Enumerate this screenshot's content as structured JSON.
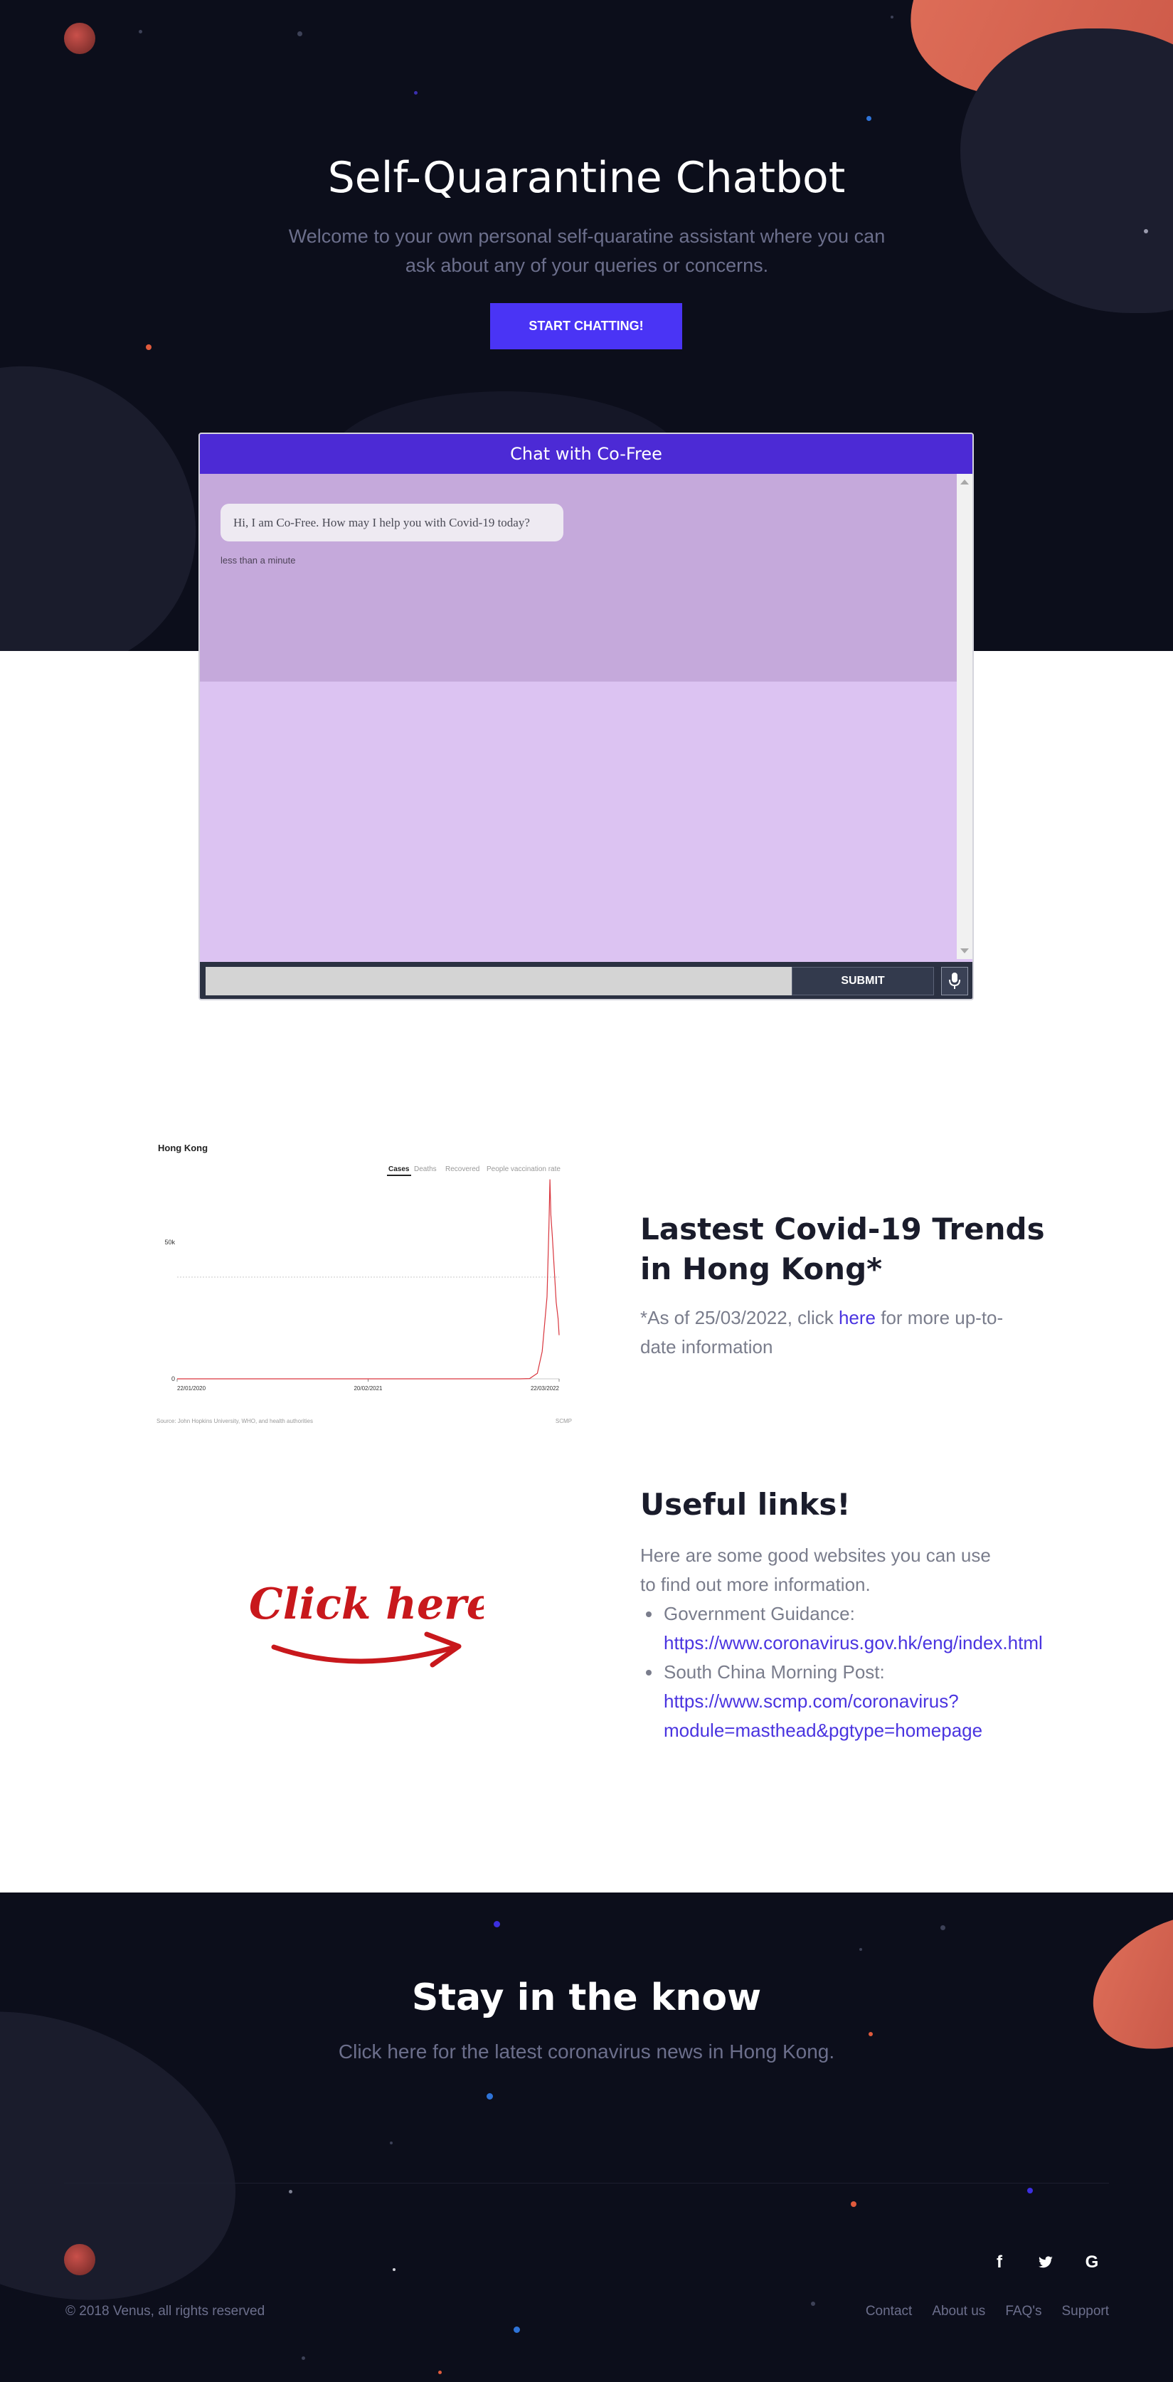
{
  "hero": {
    "title": "Self-Quarantine Chatbot",
    "subtitle": "Welcome to your own personal self-quaratine assistant where you can ask about any of your queries or concerns.",
    "cta_label": "START CHATTING!"
  },
  "chat": {
    "header": "Chat with Co-Free",
    "messages": [
      {
        "text": "Hi, I am Co-Free. How may I help you with Covid-19 today?",
        "time": "less than a minute"
      }
    ],
    "input_value": "",
    "submit_label": "SUBMIT",
    "mic_icon": "microphone-icon"
  },
  "trends": {
    "title": "Lastest Covid-19 Trends in Hong Kong*",
    "note_prefix": "*As of 25/03/2022, click ",
    "note_link": "here",
    "note_suffix": " for more up-to-date information",
    "chart_image": {
      "heading": "Hong Kong",
      "tabs": [
        "Cases",
        "Deaths",
        "Recovered",
        "People vaccination rate"
      ],
      "active_tab": "Cases",
      "source": "Source: John Hopkins University, WHO, and health authorities",
      "brand": "SCMP"
    }
  },
  "chart_data": {
    "type": "line",
    "title": "Hong Kong",
    "x_tick_labels": [
      "22/01/2020",
      "20/02/2021",
      "22/03/2022"
    ],
    "y_tick_labels": [
      "0",
      "50k"
    ],
    "ylim": [
      0,
      75000
    ],
    "series": [
      {
        "name": "Cases",
        "x": [
          "22/01/2020",
          "20/02/2021",
          "31/12/2021",
          "20/01/2022",
          "05/02/2022",
          "15/02/2022",
          "25/02/2022",
          "01/03/2022",
          "03/03/2022",
          "05/03/2022",
          "08/03/2022",
          "12/03/2022",
          "16/03/2022",
          "20/03/2022",
          "22/03/2022"
        ],
        "y": [
          0,
          0,
          0,
          100,
          2000,
          10000,
          30000,
          56000,
          73000,
          60000,
          52000,
          40000,
          28000,
          22000,
          16000
        ]
      }
    ],
    "grid": "horizontal-dotted",
    "color": "#d9363e"
  },
  "useful_links": {
    "title": "Useful links!",
    "description": "Here are some good websites you can use to find out more information.",
    "click_image_text": "Click here",
    "items": [
      {
        "label": "Government Guidance:",
        "url": "https://www.coronavirus.gov.hk/eng/index.html"
      },
      {
        "label": "South China Morning Post:",
        "url": "https://www.scmp.com/coronavirus?module=masthead&pgtype=homepage"
      }
    ]
  },
  "footer": {
    "title": "Stay in the know",
    "subtitle": "Click here for the latest coronavirus news in Hong Kong.",
    "copyright": "© 2018 Venus, all rights reserved",
    "nav": [
      "Contact",
      "About us",
      "FAQ's",
      "Support"
    ],
    "social_icons": [
      "facebook-icon",
      "twitter-icon",
      "google-icon"
    ],
    "social_glyphs": {
      "facebook": "f",
      "google": "G"
    }
  },
  "colors": {
    "dark_bg": "#0c0e1b",
    "accent": "#4a34f5",
    "chat_header": "#4c2ad5",
    "chat_body": "#dcc3f2",
    "link": "#4a34e0",
    "chart_line": "#d9363e"
  }
}
